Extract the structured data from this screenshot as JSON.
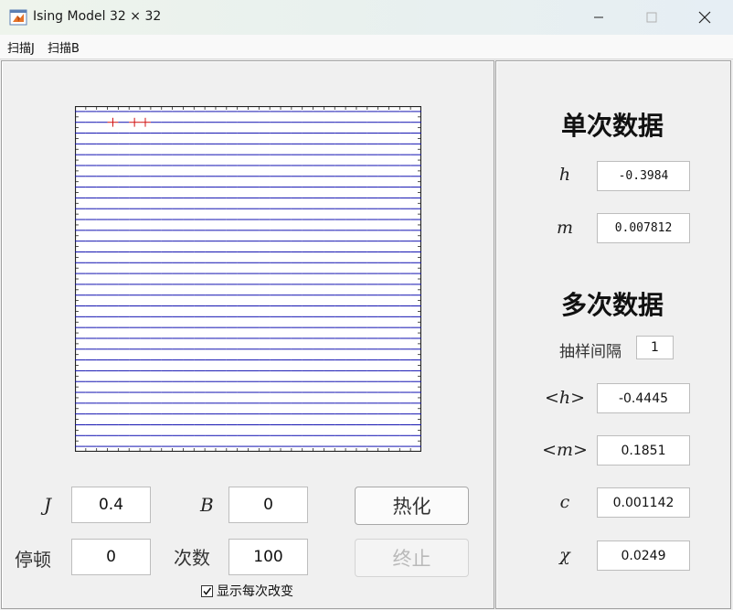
{
  "window": {
    "title": "Ising Model 32 × 32"
  },
  "menu": {
    "items": [
      "扫描J",
      "扫描B"
    ]
  },
  "controls": {
    "J_label": "J",
    "J_value": "0.4",
    "B_label": "B",
    "B_value": "0",
    "pause_label": "停顿",
    "pause_value": "0",
    "count_label": "次数",
    "count_value": "100",
    "heat_button": "热化",
    "stop_button": "终止",
    "show_each_change_label": "显示每次改变",
    "show_each_change_checked": true
  },
  "single": {
    "title": "单次数据",
    "h_label": "h",
    "h_value": "-0.3984",
    "m_label": "m",
    "m_value": "0.007812"
  },
  "multi": {
    "title": "多次数据",
    "interval_label": "抽样间隔",
    "interval_value": "1",
    "avg_h_label": "<h>",
    "avg_h_value": "-0.4445",
    "avg_m_label": "<m>",
    "avg_m_value": "0.1851",
    "c_label": "c",
    "c_value": "0.001142",
    "chi_label": "χ",
    "chi_value": "0.0249"
  },
  "lattice": {
    "size": 32,
    "up_color": "#d01010",
    "down_color": "#1010b0",
    "rows": [
      "00000000000000000000000000000000",
      "00010110000000000000000000000000",
      "00000000000000000000000000000000",
      "00000000000000000000000000000000",
      "00000000000000000000000000000000",
      "00000000000000000000000000000000",
      "00000000000000000000000000000000",
      "00000000000000000000000000000000",
      "00000000000000000000000000000000",
      "00000000000000000000000000000000",
      "00000000000000000000000000000000",
      "00000000000000000000000000000000",
      "00000000000000000000000000000000",
      "00000000000000000000000000000000",
      "00000000000000000000000000000000",
      "00000000000000000000000000000000",
      "00000000000000000000000000000000",
      "00000000000000000000000000000000",
      "00000000000000000000000000000000",
      "00000000000000000000000000000000",
      "00000000000000000000000000000000",
      "00000000000000000000000000000000",
      "00000000000000000000000000000000",
      "00000000000000000000000000000000",
      "00000000000000000000000000000000",
      "00000000000000000000000000000000",
      "00000000000000000000000000000000",
      "00000000000000000000000000000000",
      "00000000000000000000000000000000",
      "00000000000000000000000000000000",
      "00000000000000000000000000000000",
      "00000000000000000000000000000000"
    ]
  }
}
